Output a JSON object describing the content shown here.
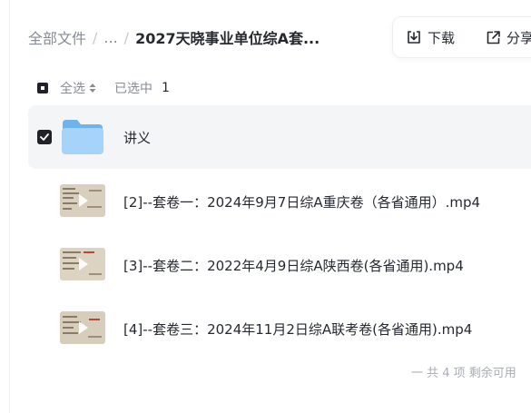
{
  "breadcrumb": {
    "root": "全部文件",
    "ellipsis": "...",
    "current": "2027天晓事业单位综A套..."
  },
  "actions": {
    "download_label": "下载",
    "share_label": "分享"
  },
  "list_header": {
    "select_all_label": "全选",
    "selected_label": "已选中",
    "selected_count": "1"
  },
  "files": [
    {
      "name": "讲义",
      "type": "folder",
      "selected": true
    },
    {
      "name": "[2]--套卷一：2024年9月7日综A重庆卷（各省通用）.mp4",
      "type": "video",
      "selected": false
    },
    {
      "name": "[3]--套卷二：2022年4月9日综A陕西卷(各省通用).mp4",
      "type": "video",
      "selected": false
    },
    {
      "name": "[4]--套卷三：2024年11月2日综A联考卷(各省通用).mp4",
      "type": "video",
      "selected": false
    }
  ],
  "footer": {
    "summary": "一 共 4 项 剩余可用"
  },
  "colors": {
    "selected_row_bg": "#f4f5f7",
    "checkbox": "#1f2329",
    "folder": "#8ec5f4"
  }
}
